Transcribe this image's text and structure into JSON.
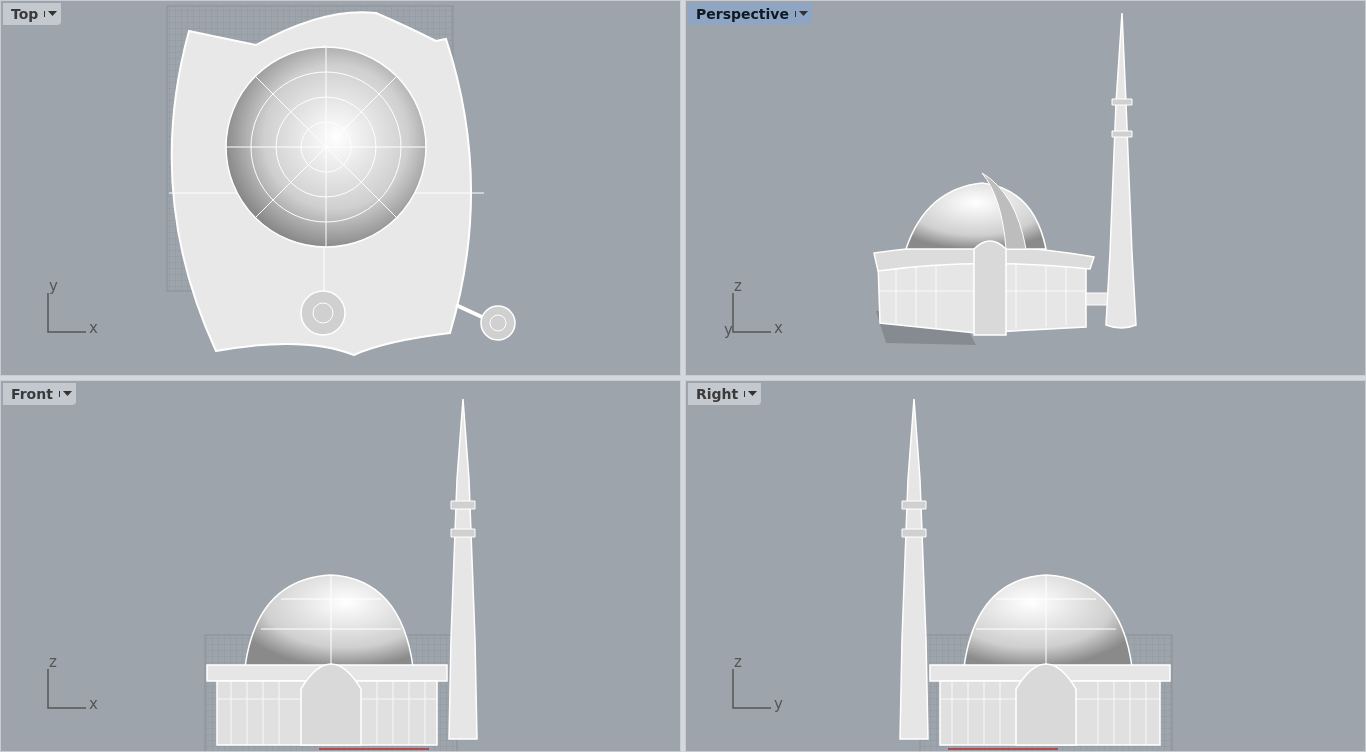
{
  "viewports": [
    {
      "kind": "top",
      "title": "Top",
      "selected": false,
      "axes": {
        "vertical": "y",
        "horizontal": "x"
      }
    },
    {
      "kind": "perspective",
      "title": "Perspective",
      "selected": true,
      "axes": {
        "vertical": "z",
        "depth": "y",
        "horizontal": "x"
      }
    },
    {
      "kind": "front",
      "title": "Front",
      "selected": false,
      "axes": {
        "vertical": "z",
        "horizontal": "x"
      }
    },
    {
      "kind": "right",
      "title": "Right",
      "selected": false,
      "axes": {
        "vertical": "z",
        "horizontal": "y"
      }
    }
  ]
}
